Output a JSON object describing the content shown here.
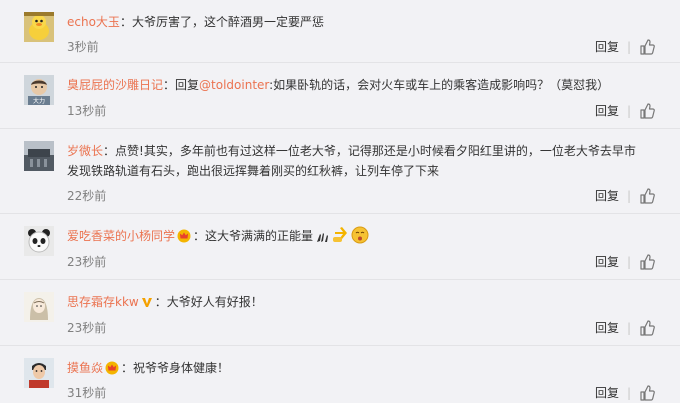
{
  "comments": [
    {
      "user": "echo大玉",
      "text": "大爷厉害了，这个醉酒男一定要严惩",
      "time": "3秒前",
      "reply": "回复"
    },
    {
      "user": "臭屁屁的沙雕日记",
      "reply_prefix": "回复",
      "mention": "@toldointer",
      "text": ":如果卧轨的话，会对火车或车上的乘客造成影响吗？（莫怼我）",
      "time": "13秒前",
      "reply": "回复"
    },
    {
      "user": "岁微长",
      "text_line1": "点赞!其实，多年前也有过这样一位老大爷，记得那还是小时候看夕阳红里讲的，一位老大爷去早市",
      "text_line2": "发现铁路轨道有石头，跑出很远挥舞着刚买的红秋裤，让列车停了下来",
      "time": "22秒前",
      "reply": "回复"
    },
    {
      "user": "爱吃香菜的小杨同学",
      "text": "这大爷满满的正能量",
      "time": "23秒前",
      "reply": "回复"
    },
    {
      "user": "思存霜存kkw",
      "text": "大爷好人有好报！",
      "time": "23秒前",
      "reply": "回复"
    },
    {
      "user": "摸鱼焱",
      "text": "祝爷爷身体健康！",
      "time": "31秒前",
      "reply": "回复"
    }
  ],
  "colors": {
    "username": "#eb7350",
    "text": "#333333",
    "time": "#808080",
    "background": "#f2f2f5",
    "divider": "#e3e3e6"
  },
  "icons": {
    "like": "thumbs-up-icon",
    "crown_badge": "crown-badge-icon",
    "vip_badge": "vip-badge-icon"
  }
}
